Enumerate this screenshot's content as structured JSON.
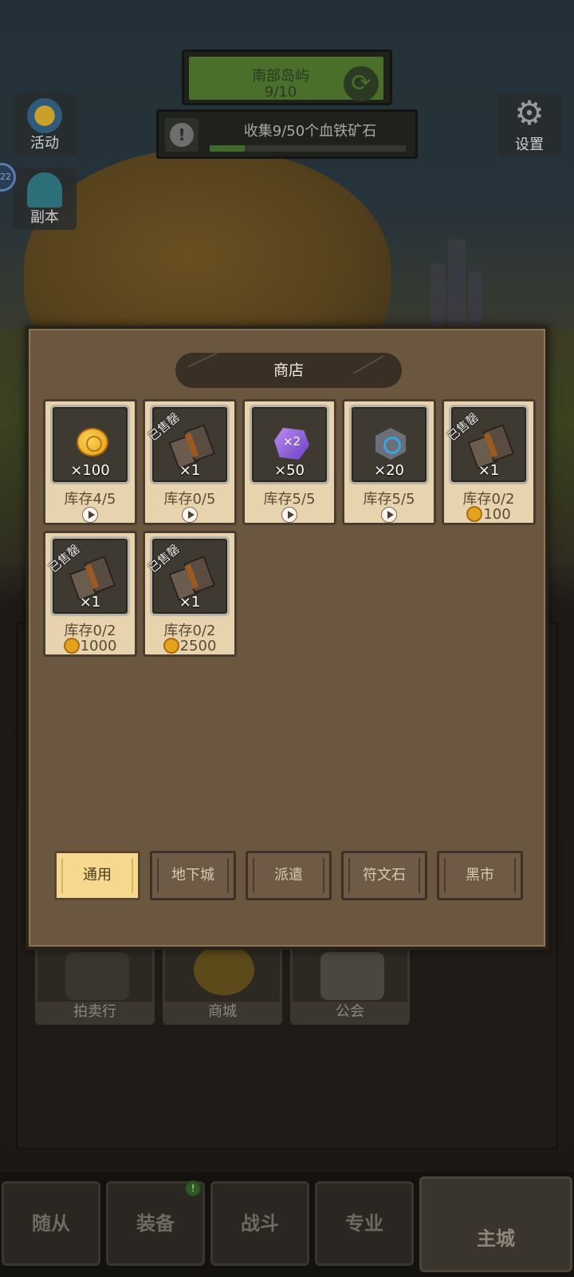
{
  "background": {
    "region": {
      "name": "南部岛屿",
      "progress": "9/10"
    },
    "quest": {
      "text": "收集9/50个血铁矿石",
      "progress_fraction": 0.18
    },
    "left_buttons": [
      {
        "label": "活动",
        "icon": "star-icon"
      },
      {
        "label": "副本",
        "icon": "portal-icon"
      }
    ],
    "bubble": "22",
    "settings_label": "设置",
    "city_buttons": [
      {
        "label": "拍卖行",
        "icon": "auction-icon"
      },
      {
        "label": "商城",
        "icon": "coin-icon"
      },
      {
        "label": "公会",
        "icon": "guild-icon"
      }
    ],
    "nav_tabs": [
      {
        "label": "随从"
      },
      {
        "label": "装备",
        "badge": "!"
      },
      {
        "label": "战斗"
      },
      {
        "label": "专业"
      },
      {
        "label": "主城",
        "active": true
      }
    ]
  },
  "shop": {
    "title": "商店",
    "items": [
      {
        "icon": "gold-coin-icon",
        "quantity": "×100",
        "stock": "库存4/5",
        "price_type": "video",
        "price": "",
        "sold_out": false
      },
      {
        "icon": "book-icon",
        "quantity": "×1",
        "stock": "库存0/5",
        "price_type": "video",
        "price": "",
        "sold_out": true,
        "sold_label": "已售罄"
      },
      {
        "icon": "purple-gem-icon",
        "icon_label": "×2",
        "quantity": "×50",
        "stock": "库存5/5",
        "price_type": "video",
        "price": "",
        "sold_out": false
      },
      {
        "icon": "rune-stone-icon",
        "quantity": "×20",
        "stock": "库存5/5",
        "price_type": "video",
        "price": "",
        "sold_out": false
      },
      {
        "icon": "book-icon",
        "quantity": "×1",
        "stock": "库存0/2",
        "price_type": "gold",
        "price": "100",
        "sold_out": true,
        "sold_label": "已售罄"
      },
      {
        "icon": "book-icon",
        "quantity": "×1",
        "stock": "库存0/2",
        "price_type": "gold",
        "price": "1000",
        "sold_out": true,
        "sold_label": "已售罄"
      },
      {
        "icon": "book-icon",
        "quantity": "×1",
        "stock": "库存0/2",
        "price_type": "gold",
        "price": "2500",
        "sold_out": true,
        "sold_label": "已售罄"
      }
    ],
    "tabs": [
      {
        "label": "通用",
        "active": true
      },
      {
        "label": "地下城"
      },
      {
        "label": "派遣"
      },
      {
        "label": "符文石"
      },
      {
        "label": "黑市"
      }
    ]
  },
  "colors": {
    "panel": "#6b5640",
    "card": "#e7d3ad",
    "tab_active": "#f6d98e"
  }
}
